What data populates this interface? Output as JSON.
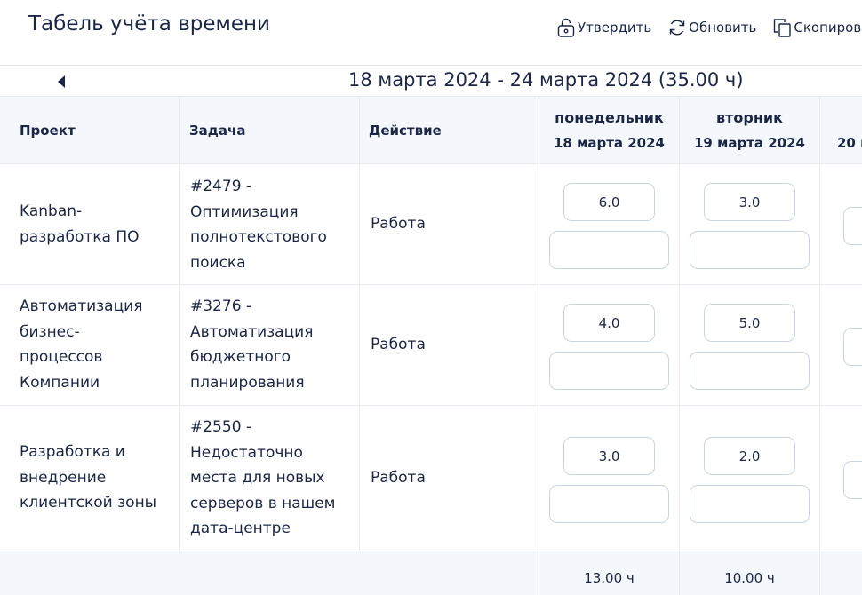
{
  "header": {
    "title": "Табель учёта времени",
    "actions": {
      "approve": "Утвердить",
      "refresh": "Обновить",
      "copy": "Скопиров"
    }
  },
  "week": {
    "range": "18 марта 2024 - 24 марта 2024 (35.00 ч)"
  },
  "table": {
    "columns": {
      "project": "Проект",
      "task": "Задача",
      "action": "Действие"
    },
    "days": [
      {
        "name": "понедельник",
        "date": "18 марта 2024"
      },
      {
        "name": "вторник",
        "date": "19 марта 2024"
      },
      {
        "name": "",
        "date": "20 м"
      }
    ],
    "rows": [
      {
        "project": [
          "Kanban-",
          "разработка ПО"
        ],
        "task": [
          "#2479 -",
          "Оптимизация",
          "полнотекстового",
          "поиска"
        ],
        "action": "Работа",
        "hours": [
          "6.0",
          "3.0"
        ]
      },
      {
        "project": [
          "Автоматизация",
          "бизнес-",
          "процессов",
          "Компании"
        ],
        "task": [
          "#3276 -",
          "Автоматизация",
          "бюджетного",
          "планирования"
        ],
        "action": "Работа",
        "hours": [
          "4.0",
          "5.0"
        ]
      },
      {
        "project": [
          "Разработка и",
          "внедрение",
          "клиентской зоны"
        ],
        "task": [
          "#2550 -",
          "Недостаточно",
          "места для новых",
          "серверов в нашем",
          "дата-центре"
        ],
        "action": "Работа",
        "hours": [
          "3.0",
          "2.0"
        ]
      }
    ],
    "totals": [
      "13.00 ч",
      "10.00 ч"
    ]
  }
}
